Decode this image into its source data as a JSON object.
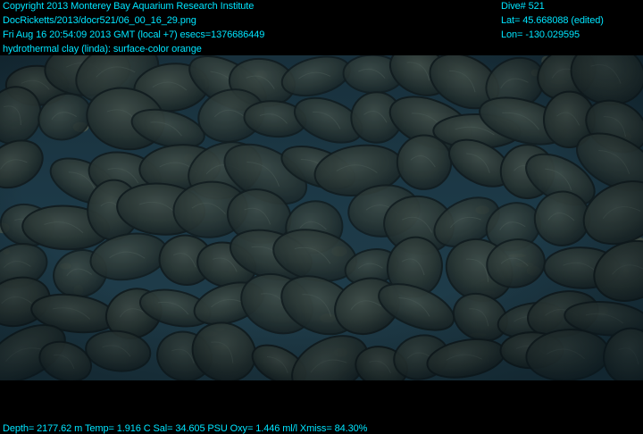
{
  "overlay": {
    "text_color": "#00e5ff",
    "background_color": "#000000",
    "copyright": "Copyright 2013 Monterey Bay Aquarium Research Institute",
    "file_path": "DocRicketts/2013/docr521/06_00_16_29.png",
    "timestamp": "Fri Aug 16 20:54:09 2013 GMT (local +7)  esecs=1376686449",
    "annotation": "hydrothermal clay (linda): surface-color orange",
    "dive": "Dive# 521",
    "latitude": "Lat= 45.668088 (edited)",
    "longitude": "Lon= -130.029595",
    "sensors": "Depth= 2177.62 m  Temp= 1.916 C  Sal= 34.605 PSU  Oxy= 1.446 ml/l  Xmiss= 84.30%"
  },
  "scene": {
    "subject": "pillow lava seafloor",
    "water_color": "#1d3a48",
    "rock_color": "#2c3a3a",
    "sediment_color": "#7a7a5a"
  }
}
